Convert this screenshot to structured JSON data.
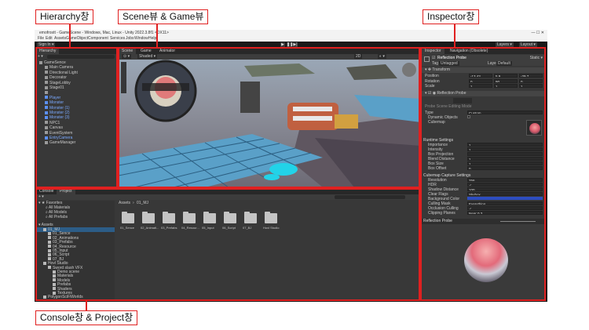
{
  "callouts": {
    "hierarchy": "Hierarchy창",
    "scene_game": "Scene뷰 & Game뷰",
    "inspector": "Inspector창",
    "console_project": "Console창 & Project창"
  },
  "window": {
    "title": "emofrostt - GameScene - Windows, Mac, Linux - Unity 2022.3.8f1 <DX11>",
    "menu": [
      "File",
      "Edit",
      "Assets",
      "GameObject",
      "Component",
      "Services",
      "Jobs",
      "Window",
      "Help"
    ],
    "account": "Sign In ▾",
    "layers": "Layers ▾",
    "layout": "Layout ▾"
  },
  "hierarchy": {
    "tab": "Hierarchy",
    "search_placeholder": "All",
    "items": [
      {
        "label": "GameSence",
        "indent": 0,
        "blue": false
      },
      {
        "label": "Main Camera",
        "indent": 1,
        "blue": false
      },
      {
        "label": "Directional Light",
        "indent": 1,
        "blue": false
      },
      {
        "label": "Decorator",
        "indent": 1,
        "blue": false
      },
      {
        "label": "StageLobby",
        "indent": 1,
        "blue": false
      },
      {
        "label": "Stage01",
        "indent": 1,
        "blue": false
      },
      {
        "label": "",
        "indent": 1,
        "blue": false
      },
      {
        "label": "Player",
        "indent": 1,
        "blue": true
      },
      {
        "label": "Monster",
        "indent": 1,
        "blue": true
      },
      {
        "label": "Monster (1)",
        "indent": 1,
        "blue": true
      },
      {
        "label": "Monster (2)",
        "indent": 1,
        "blue": true
      },
      {
        "label": "Monster (3)",
        "indent": 1,
        "blue": true
      },
      {
        "label": "NPC1",
        "indent": 1,
        "blue": false
      },
      {
        "label": "Canvas",
        "indent": 1,
        "blue": false
      },
      {
        "label": "EventSystem",
        "indent": 1,
        "blue": false
      },
      {
        "label": "EntryCamera",
        "indent": 1,
        "blue": true
      },
      {
        "label": "GameManager",
        "indent": 1,
        "blue": false
      }
    ]
  },
  "scene": {
    "tabs": [
      "Scene",
      "Game",
      "Animator"
    ],
    "shading": "Shaded ▾",
    "mode": "2D"
  },
  "inspector": {
    "tabs": [
      "Inspector",
      "Navigation (Obsolete)"
    ],
    "object_name": "Reflection Probe",
    "static": "Static ▾",
    "tag_label": "Tag",
    "tag_value": "Untagged",
    "layer_label": "Layer",
    "layer_value": "Default",
    "transform_header": "Transform",
    "transform": [
      {
        "label": "Position",
        "x": "-13.43",
        "y": "5.9",
        "z": "-29.7"
      },
      {
        "label": "Rotation",
        "x": "0",
        "y": "90",
        "z": "0"
      },
      {
        "label": "Scale",
        "x": "1",
        "y": "1",
        "z": "1"
      }
    ],
    "probe_header": "Reflection Probe",
    "edit_bounds": "Probe Scene Editing Mode",
    "type_label": "Type",
    "type_value": "Custom",
    "dynamic_objects": "Dynamic Objects",
    "cubemap": "Cubemap",
    "runtime_header": "Runtime Settings",
    "runtime": [
      {
        "label": "Importance",
        "value": "1"
      },
      {
        "label": "Intensity",
        "value": "1"
      },
      {
        "label": "Box Projection",
        "value": ""
      },
      {
        "label": "Blend Distance",
        "value": "1"
      },
      {
        "label": "Box Size",
        "value": "1"
      },
      {
        "label": "Box Offset",
        "value": "0"
      }
    ],
    "capture_header": "Cubemap Capture Settings",
    "capture": [
      {
        "label": "Resolution",
        "value": "256"
      },
      {
        "label": "HDR",
        "value": "✓"
      },
      {
        "label": "Shadow Distance",
        "value": "100"
      },
      {
        "label": "Clear Flags",
        "value": "Skybox"
      },
      {
        "label": "Background Color",
        "value": ""
      },
      {
        "label": "Culling Mask",
        "value": "Everything"
      },
      {
        "label": "Occlusion Culling",
        "value": "✓"
      },
      {
        "label": "Clipping Planes",
        "value": "Near 0.3"
      }
    ],
    "preview_label": "Reflection Probe"
  },
  "project": {
    "tabs": [
      "Console",
      "Project"
    ],
    "favorites_header": "Favorites",
    "favorites": [
      "All Materials",
      "All Models",
      "All Prefabs"
    ],
    "assets_header": "Assets",
    "assets_tree": [
      {
        "label": "01_MJ",
        "indent": 1
      },
      {
        "label": "01_Sence",
        "indent": 2
      },
      {
        "label": "02_Animations",
        "indent": 2
      },
      {
        "label": "03_Prefabs",
        "indent": 2
      },
      {
        "label": "04_Resource",
        "indent": 2
      },
      {
        "label": "05_Input",
        "indent": 2
      },
      {
        "label": "06_Script",
        "indent": 2
      },
      {
        "label": "07_BJ",
        "indent": 2
      },
      {
        "label": "Hovl Studio",
        "indent": 1
      },
      {
        "label": "Sword slash VFX",
        "indent": 2
      },
      {
        "label": "Demo scene",
        "indent": 3
      },
      {
        "label": "Materials",
        "indent": 3
      },
      {
        "label": "Models",
        "indent": 3
      },
      {
        "label": "Prefabs",
        "indent": 3
      },
      {
        "label": "Shaders",
        "indent": 3
      },
      {
        "label": "Textures",
        "indent": 3
      },
      {
        "label": "PolygonSciFiWorlds",
        "indent": 1
      }
    ],
    "breadcrumb": [
      "Assets",
      "01_MJ"
    ],
    "folders": [
      "01_Sence",
      "02_Animati...",
      "03_Prefabs",
      "04_Resour...",
      "05_Input",
      "06_Script",
      "07_BJ",
      "Hovl Studio"
    ]
  }
}
